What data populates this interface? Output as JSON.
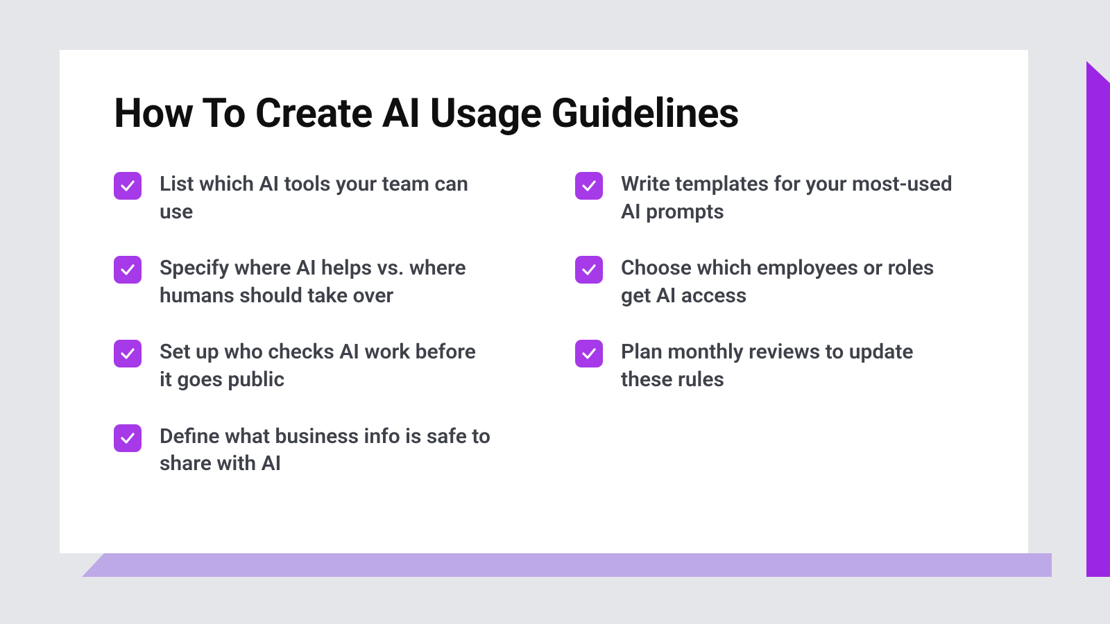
{
  "title": "How To Create AI Usage Guidelines",
  "columns": {
    "left": [
      "List which AI tools your team can use",
      "Specify where AI helps vs. where humans should take over",
      "Set up who checks AI work before it goes public",
      "Define what business info is safe to share with AI"
    ],
    "right": [
      "Write templates for your most-used AI prompts",
      "Choose which employees or roles get AI access",
      "Plan monthly reviews to update these rules"
    ]
  },
  "colors": {
    "accent": "#A639E8",
    "accent_dark": "#9B27E4",
    "accent_light": "#BDA8E8",
    "bg": "#E5E6EA",
    "text_body": "#3E4149"
  }
}
